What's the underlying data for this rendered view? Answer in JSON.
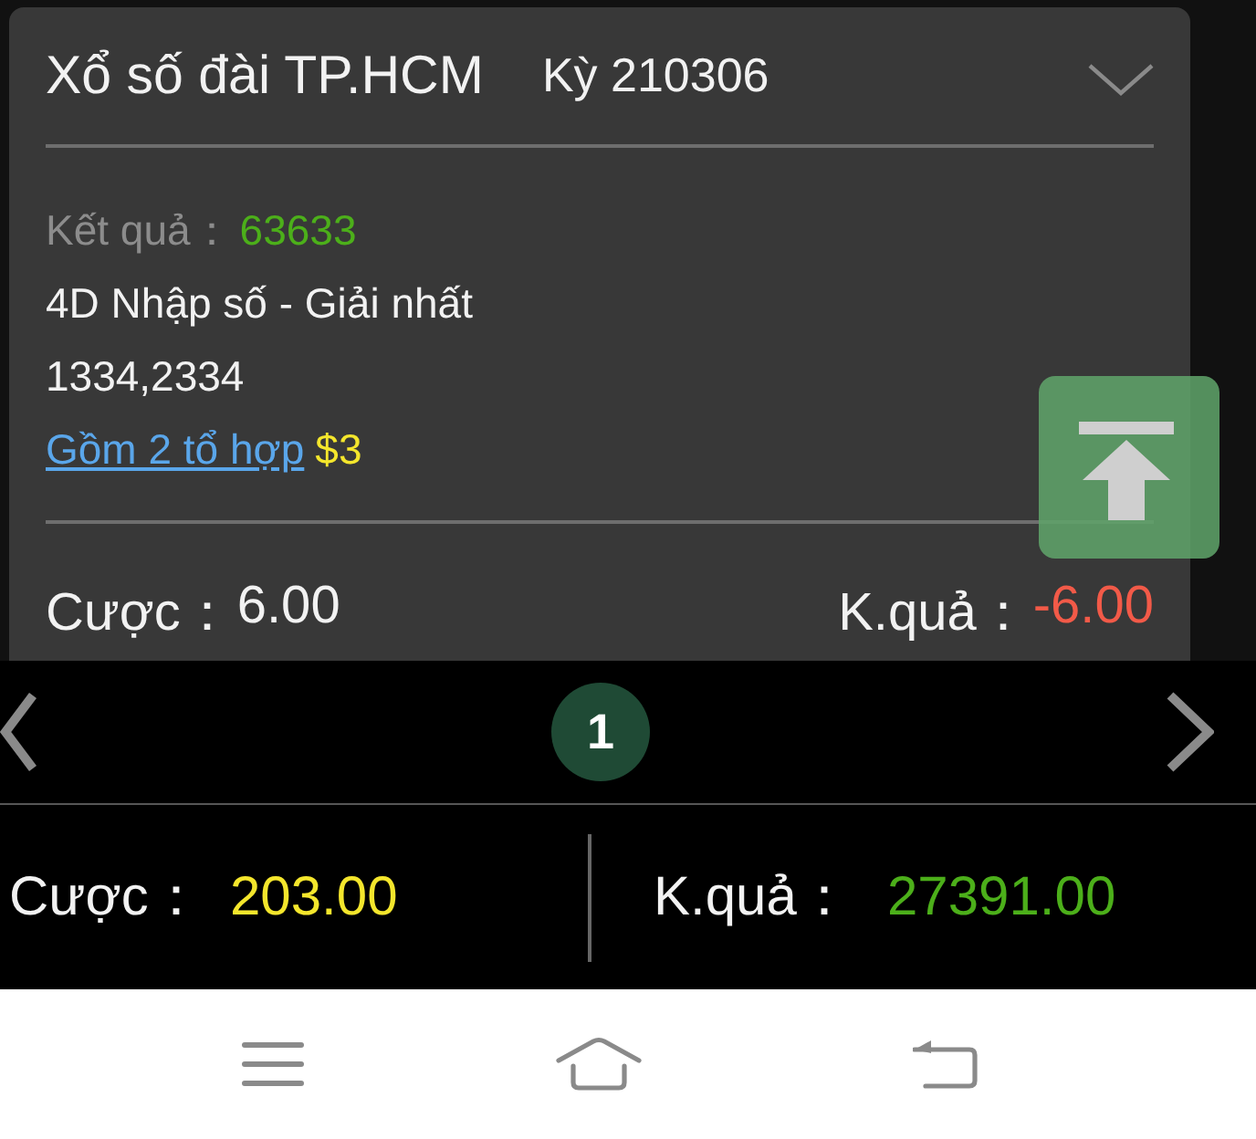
{
  "card": {
    "title": "Xổ số đài TP.HCM",
    "period": "Kỳ 210306",
    "result": {
      "label": "Kết quả：",
      "value": "63633"
    },
    "bet_type": "4D Nhập số - Giải nhất",
    "numbers": "1334,2334",
    "combo_link": "Gồm 2 tổ hợp",
    "combo_amount": "$3",
    "stake": {
      "label": "Cược：",
      "value": "6.00"
    },
    "payout": {
      "label": "K.quả：",
      "value": "-6.00"
    }
  },
  "pagination": {
    "pages": [
      {
        "label": "1",
        "selected": true
      }
    ]
  },
  "summary": {
    "stake": {
      "label": "Cược：",
      "value": "203.00"
    },
    "payout": {
      "label": "K.quả：",
      "value": "27391.00"
    }
  }
}
